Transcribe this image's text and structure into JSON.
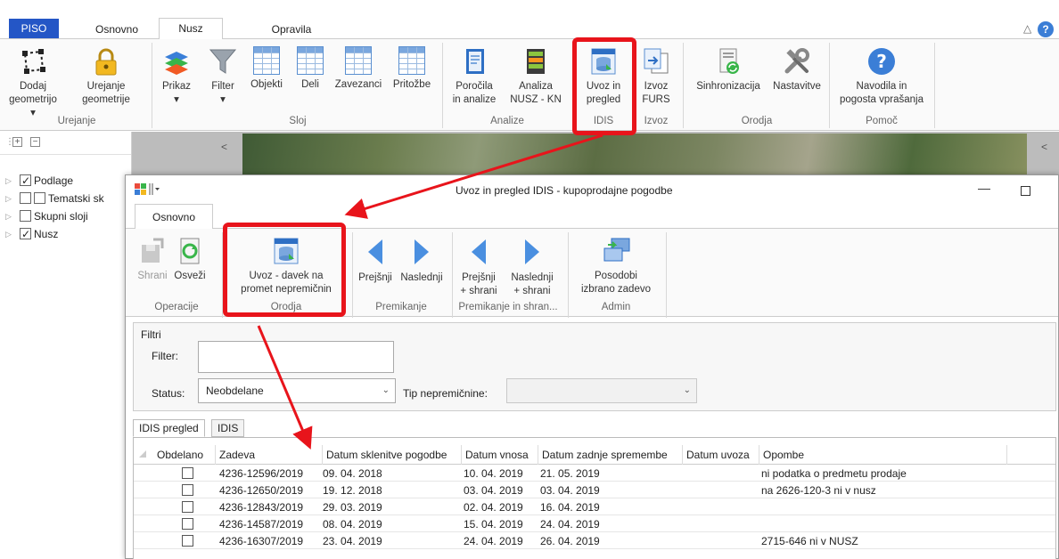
{
  "app": {
    "tabs": [
      "PISO",
      "Osnovno",
      "Nusz",
      "Opravila"
    ],
    "colors": {
      "piso_tab": "#2456c6",
      "highlight": "#e8141b",
      "arrow_blue": "#4a8fe0"
    },
    "ribbon": {
      "urejanje": {
        "label": "Urejanje",
        "buttons": [
          {
            "line1": "Dodaj",
            "line2": "geometrijo ▾",
            "icon": "polygon-icon"
          },
          {
            "line1": "Urejanje",
            "line2": "geometrije",
            "icon": "lock-icon"
          }
        ]
      },
      "sloj": {
        "label": "Sloj",
        "buttons": [
          {
            "line1": "Prikaz",
            "line2": "▾",
            "icon": "layers-icon"
          },
          {
            "line1": "Filter",
            "line2": "▾",
            "icon": "filter-icon"
          },
          {
            "line1": "Objekti",
            "icon": "grid-icon"
          },
          {
            "line1": "Deli",
            "icon": "grid-icon"
          },
          {
            "line1": "Zavezanci",
            "icon": "grid-icon"
          },
          {
            "line1": "Pritožbe",
            "icon": "grid-icon"
          }
        ]
      },
      "analize": {
        "label": "Analize",
        "buttons": [
          {
            "line1": "Poročila",
            "line2": "in analize",
            "icon": "report-icon"
          },
          {
            "line1": "Analiza",
            "line2": "NUSZ - KN",
            "icon": "analysis-icon"
          }
        ]
      },
      "idis": {
        "label": "IDIS",
        "buttons": [
          {
            "line1": "Uvoz in",
            "line2": "pregled",
            "icon": "database-import-icon"
          }
        ]
      },
      "izvoz": {
        "label": "Izvoz",
        "buttons": [
          {
            "line1": "Izvoz",
            "line2": "FURS",
            "icon": "export-icon"
          }
        ]
      },
      "orodja": {
        "label": "Orodja",
        "buttons": [
          {
            "line1": "Sinhronizacija",
            "icon": "sync-icon"
          },
          {
            "line1": "Nastavitve",
            "icon": "tools-icon"
          }
        ]
      },
      "pomoc": {
        "label": "Pomoč",
        "buttons": [
          {
            "line1": "Navodila in",
            "line2": "pogosta vprašanja",
            "icon": "help-icon"
          }
        ]
      }
    },
    "left_panel": {
      "items": [
        {
          "label": "Podlage",
          "checked": true
        },
        {
          "label": "Tematski sk",
          "checked": false
        },
        {
          "label": "Skupni sloji",
          "checked": false
        },
        {
          "label": "Nusz",
          "checked": true
        }
      ]
    }
  },
  "dialog": {
    "title": "Uvoz in pregled IDIS - kupoprodajne pogodbe",
    "tab": "Osnovno",
    "ribbon": {
      "operacije": {
        "label": "Operacije",
        "buttons": [
          {
            "line1": "Shrani",
            "icon": "save-icon"
          },
          {
            "line1": "Osveži",
            "icon": "refresh-icon"
          }
        ]
      },
      "orodja": {
        "label": "Orodja",
        "buttons": [
          {
            "line1": "Uvoz - davek na",
            "line2": "promet nepremičnin",
            "icon": "database-import-icon"
          }
        ]
      },
      "premikanje": {
        "label": "Premikanje",
        "buttons": [
          {
            "line1": "Prejšnji",
            "icon": "arrow-left-icon"
          },
          {
            "line1": "Naslednji",
            "icon": "arrow-right-icon"
          }
        ]
      },
      "premikanje_shrani": {
        "label": "Premikanje in shran...",
        "buttons": [
          {
            "line1": "Prejšnji",
            "line2": "+ shrani",
            "icon": "arrow-left-icon"
          },
          {
            "line1": "Naslednji",
            "line2": "+ shrani",
            "icon": "arrow-right-icon"
          }
        ]
      },
      "admin": {
        "label": "Admin",
        "buttons": [
          {
            "line1": "Posodobi",
            "line2": "izbrano zadevo",
            "icon": "update-icon"
          }
        ]
      }
    },
    "filters": {
      "title": "Filtri",
      "filter_label": "Filter:",
      "filter_value": "",
      "status_label": "Status:",
      "status_value": "Neobdelane",
      "tip_label": "Tip nepremičnine:",
      "tip_value": ""
    },
    "grid": {
      "tabs": [
        "IDIS pregled",
        "IDIS"
      ],
      "columns": [
        "Obdelano",
        "Zadeva",
        "Datum sklenitve pogodbe",
        "Datum vnosa",
        "Datum zadnje spremembe",
        "Datum uvoza",
        "Opombe"
      ],
      "rows": [
        {
          "zadeva": "4236-12596/2019",
          "sklenitev": "09. 04. 2018",
          "vnos": "10. 04. 2019",
          "sprememba": "21. 05. 2019",
          "uvoz": "",
          "opombe": "ni podatka o predmetu prodaje"
        },
        {
          "zadeva": "4236-12650/2019",
          "sklenitev": "19. 12. 2018",
          "vnos": "03. 04. 2019",
          "sprememba": "03. 04. 2019",
          "uvoz": "",
          "opombe": "na 2626-120-3 ni v nusz"
        },
        {
          "zadeva": "4236-12843/2019",
          "sklenitev": "29. 03. 2019",
          "vnos": "02. 04. 2019",
          "sprememba": "16. 04. 2019",
          "uvoz": "",
          "opombe": ""
        },
        {
          "zadeva": "4236-14587/2019",
          "sklenitev": "08. 04. 2019",
          "vnos": "15. 04. 2019",
          "sprememba": "24. 04. 2019",
          "uvoz": "",
          "opombe": ""
        },
        {
          "zadeva": "4236-16307/2019",
          "sklenitev": "23. 04. 2019",
          "vnos": "24. 04. 2019",
          "sprememba": "26. 04. 2019",
          "uvoz": "",
          "opombe": "2715-646 ni v NUSZ"
        }
      ]
    }
  }
}
